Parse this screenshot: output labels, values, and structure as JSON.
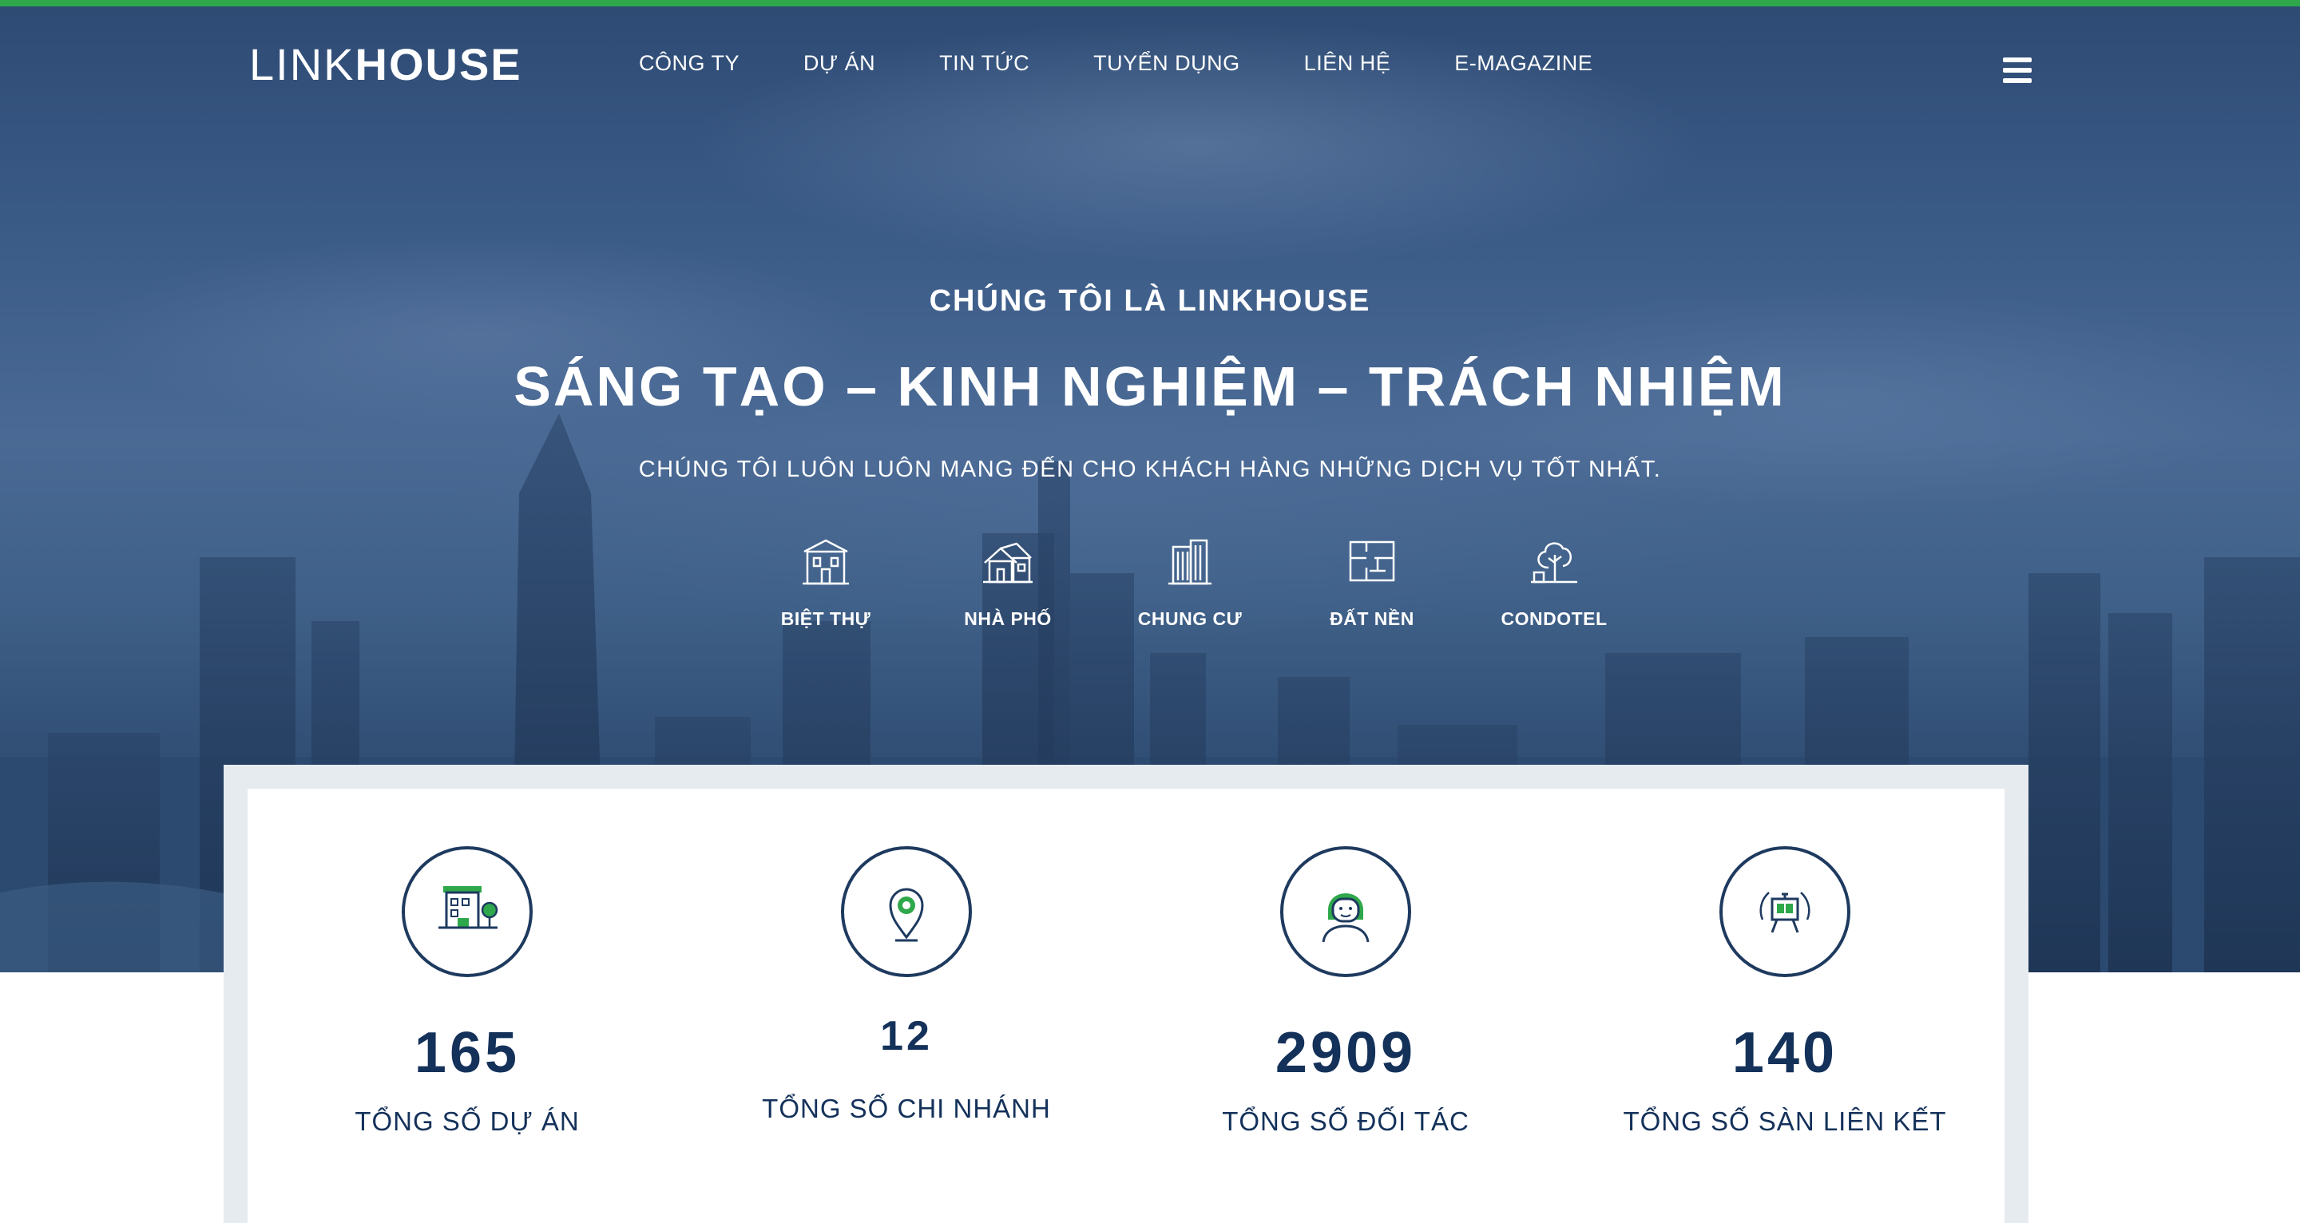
{
  "brand": {
    "logo_light": "LINK",
    "logo_bold": "HOUSE",
    "accent": "#2ea84a",
    "navy": "#14315a"
  },
  "nav": {
    "items": [
      {
        "label": "CÔNG TY"
      },
      {
        "label": "DỰ ÁN"
      },
      {
        "label": "TIN TỨC"
      },
      {
        "label": "TUYỂN DỤNG"
      },
      {
        "label": "LIÊN HỆ"
      },
      {
        "label": "E-MAGAZINE"
      }
    ],
    "menu_icon": "hamburger-icon"
  },
  "hero": {
    "eyebrow": "CHÚNG TÔI LÀ LINKHOUSE",
    "headline": "SÁNG TẠO – KINH NGHIỆM – TRÁCH NHIỆM",
    "subline": "CHÚNG TÔI LUÔN LUÔN MANG ĐẾN CHO KHÁCH HÀNG NHỮNG DỊCH VỤ TỐT NHẤT."
  },
  "categories": [
    {
      "label": "BIỆT THỰ",
      "icon": "villa-icon"
    },
    {
      "label": "NHÀ PHỐ",
      "icon": "townhouse-icon"
    },
    {
      "label": "CHUNG CƯ",
      "icon": "apartment-icon"
    },
    {
      "label": "ĐẤT NỀN",
      "icon": "land-plot-icon"
    },
    {
      "label": "CONDOTEL",
      "icon": "condotel-icon"
    }
  ],
  "stats": [
    {
      "value": "165",
      "label": "TỔNG SỐ DỰ ÁN",
      "icon": "building-tree-icon"
    },
    {
      "value": "12",
      "label": "TỔNG SỐ CHI NHÁNH",
      "icon": "location-pin-icon"
    },
    {
      "value": "2909",
      "label": "TỔNG SỐ ĐỐI TÁC",
      "icon": "partner-person-icon"
    },
    {
      "value": "140",
      "label": "TỔNG SỐ SÀN LIÊN KẾT",
      "icon": "presentation-icon"
    }
  ]
}
